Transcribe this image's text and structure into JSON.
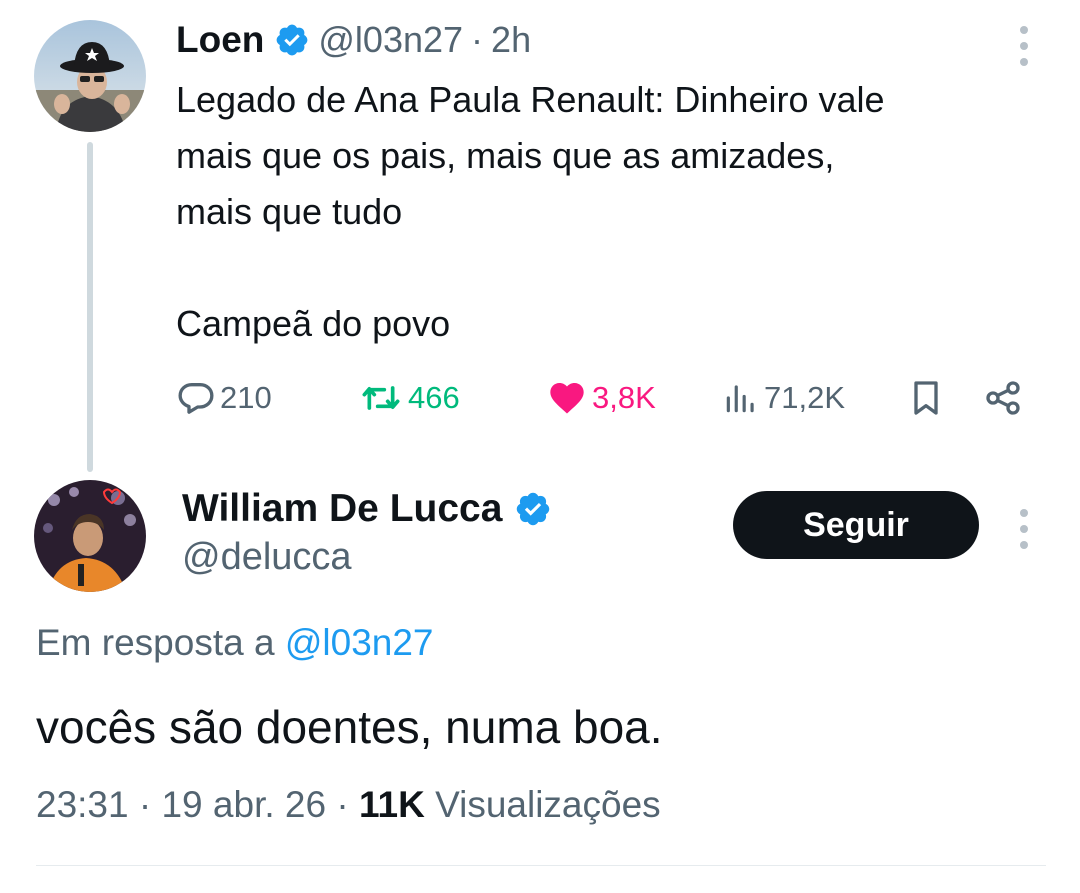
{
  "parent_tweet": {
    "author": {
      "name": "Loen",
      "handle": "@l03n27",
      "verified": true
    },
    "separator": "·",
    "time": "2h",
    "text_lines": [
      "Legado de Ana Paula Renault: Dinheiro vale",
      "mais que os pais, mais que as amizades,",
      "mais que tudo",
      "Campeã do povo"
    ],
    "actions": {
      "replies": "210",
      "retweets": "466",
      "likes": "3,8K",
      "views": "71,2K"
    }
  },
  "main_tweet": {
    "author": {
      "name": "William De Lucca",
      "handle": "@delucca",
      "verified": true
    },
    "follow_label": "Seguir",
    "reply_prefix": "Em resposta a",
    "reply_mention": "@l03n27",
    "text": "vocês são doentes, numa boa.",
    "time": "23:31",
    "separator": "·",
    "date": "19 abr. 26",
    "views_count": "11K",
    "views_label": "Visualizações"
  },
  "colors": {
    "text": "#0f1419",
    "secondary": "#536471",
    "verified": "#1d9bf0",
    "retweet_active": "#00ba7c",
    "like_active": "#f91880",
    "button_bg": "#0f1419"
  },
  "icons": {
    "verified": "verified-badge-icon",
    "reply": "comment-icon",
    "retweet": "retweet-icon",
    "like": "heart-icon",
    "views": "analytics-icon",
    "bookmark": "bookmark-icon",
    "share": "share-icon",
    "more": "kebab-icon"
  }
}
